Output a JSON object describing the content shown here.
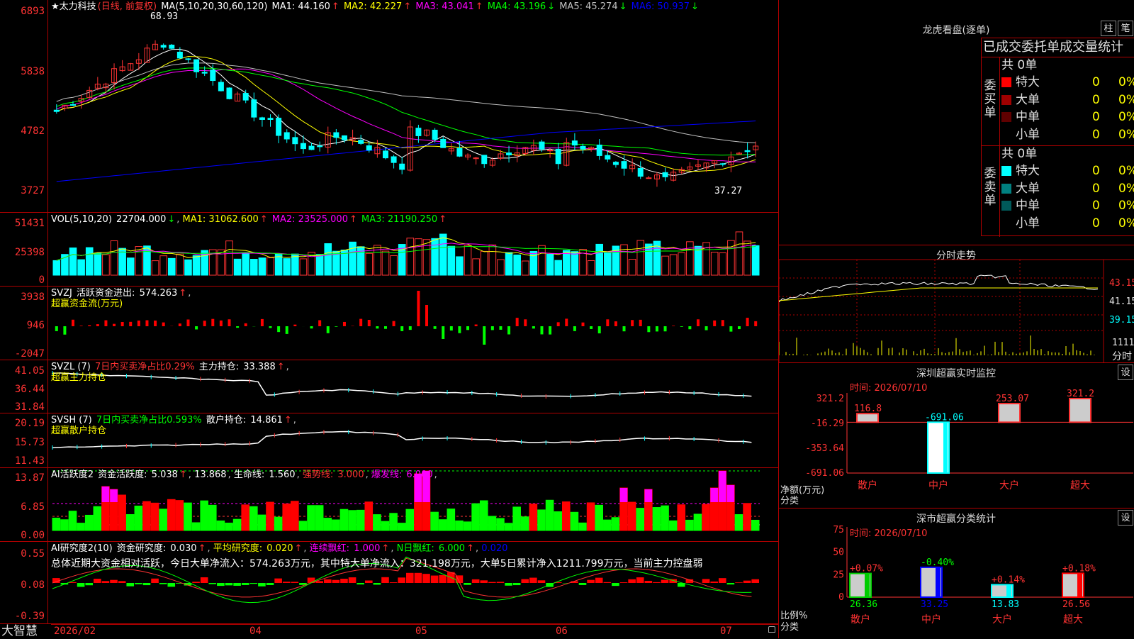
{
  "main": {
    "title": "★太力科技",
    "period": "(日线, 前复权)",
    "ma_header": "MA(5,10,20,30,60,120)",
    "ma": [
      {
        "label": "MA1:",
        "value": "44.160",
        "arrow": "↑",
        "color": "#ffffff"
      },
      {
        "label": "MA2:",
        "value": "42.227",
        "arrow": "↑",
        "color": "#ffff00"
      },
      {
        "label": "MA3:",
        "value": "43.041",
        "arrow": "↑",
        "color": "#ff00ff"
      },
      {
        "label": "MA4:",
        "value": "43.196",
        "arrow": "↓",
        "color": "#00ff00"
      },
      {
        "label": "MA5:",
        "value": "45.274",
        "arrow": "↓",
        "color": "#c0c0c0"
      },
      {
        "label": "MA6:",
        "value": "50.937",
        "arrow": "↓",
        "color": "#0000ff"
      }
    ],
    "ticks": [
      "6893",
      "5838",
      "4782",
      "3727"
    ],
    "high_label": "68.93",
    "low_label": "37.27"
  },
  "vol": {
    "header": "VOL(5,10,20)",
    "value": "22704.000",
    "value_arrow": "↓",
    "ma": [
      {
        "label": "MA1:",
        "value": "31062.600",
        "arrow": "↑",
        "color": "#ffff00"
      },
      {
        "label": "MA2:",
        "value": "23525.000",
        "arrow": "↑",
        "color": "#ff00ff"
      },
      {
        "label": "MA3:",
        "value": "21190.250",
        "arrow": "↑",
        "color": "#00ff00"
      }
    ],
    "ticks": [
      "51431",
      "25398",
      "0"
    ]
  },
  "svzj": {
    "header": "SVZJ",
    "label": "活跃资金进出:",
    "value": "574.263",
    "arrow": "↑",
    "sub": "超赢资金流(万元)",
    "ticks": [
      "3938",
      "946",
      "-2047"
    ]
  },
  "svzl": {
    "header": "SVZL (7)",
    "ratio": "7日内买卖净占比0.29%",
    "label": "主力持仓:",
    "value": "33.388",
    "arrow": "↑",
    "sub": "超赢主力持仓",
    "ticks": [
      "41.05",
      "36.44",
      "31.84"
    ]
  },
  "svsh": {
    "header": "SVSH (7)",
    "ratio": "7日内买卖净占比0.593%",
    "label": "散户持仓:",
    "value": "14.861",
    "arrow": "↑",
    "sub": "超赢散户持仓",
    "ticks": [
      "20.19",
      "15.73",
      "11.43"
    ]
  },
  "ai1": {
    "header": "AI活跃度2",
    "label": "资金活跃度:",
    "value": "5.038",
    "v2": "13.868",
    "life_label": "生命线:",
    "life": "1.560",
    "strong_label": "强势线:",
    "strong": "3.000",
    "burst_label": "爆发线:",
    "burst": "6.000",
    "ticks": [
      "13.87",
      "6.85",
      "0.00"
    ]
  },
  "ai2": {
    "header": "AI研究度2(10)",
    "label": "资金研究度:",
    "value": "0.030",
    "avg_label": "平均研究度:",
    "avg": "0.020",
    "lian_label": "连续飘红:",
    "lian": "1.000",
    "n_label": "N日飘红:",
    "n": "6.000",
    "last": "0.020",
    "summary": "总体近期大资金相对活跃，今日大单净流入：574.263万元，其中特大单净流入：321.198万元，大单5日累计净入1211.799万元，当前主力控盘弱",
    "ticks": [
      "0.55",
      "0.08",
      "-0.39"
    ]
  },
  "dates": [
    "2026/02",
    "04",
    "05",
    "06",
    "07"
  ],
  "brand": "大智慧",
  "lhb": {
    "title": "龙虎看盘(逐单)",
    "btn1": "柱",
    "btn2": "笔",
    "subtitle": "已成交委托单成交量统计",
    "buy_total": "共 0单",
    "sell_total": "共 0单",
    "buy_label": "委买单",
    "sell_label": "委卖单",
    "buy_rows": [
      {
        "name": "特大",
        "v": "0",
        "p": "0%",
        "color": "#ff0000"
      },
      {
        "name": "大单",
        "v": "0",
        "p": "0%",
        "color": "#a00000"
      },
      {
        "name": "中单",
        "v": "0",
        "p": "0%",
        "color": "#600000"
      },
      {
        "name": "小单",
        "v": "0",
        "p": "0%",
        "color": "#000000"
      }
    ],
    "sell_rows": [
      {
        "name": "特大",
        "v": "0",
        "p": "0%",
        "color": "#00ffff"
      },
      {
        "name": "大单",
        "v": "0",
        "p": "0%",
        "color": "#008080"
      },
      {
        "name": "中单",
        "v": "0",
        "p": "0%",
        "color": "#005a5a"
      },
      {
        "name": "小单",
        "v": "0",
        "p": "0%",
        "color": "#000000"
      }
    ]
  },
  "fenshi": {
    "title": "分时走势",
    "ticks": [
      "43.15",
      "41.15",
      "39.15"
    ],
    "vol_tick": "1111",
    "vol_label": "分时"
  },
  "monitor": {
    "title": "深圳超赢实时监控",
    "btn": "设",
    "time": "时间: 2026/07/10",
    "ticks": [
      "321.2",
      "-16.29",
      "-353.64",
      "-691.06"
    ],
    "axis_label": "净额(万元)",
    "axis_label2": "分类",
    "bars": [
      {
        "cat": "散户",
        "value": 116.8,
        "label": "116.8"
      },
      {
        "cat": "中户",
        "value": -691.06,
        "label": "-691.06"
      },
      {
        "cat": "大户",
        "value": 253.07,
        "label": "253.07"
      },
      {
        "cat": "超大",
        "value": 321.2,
        "label": "321.2"
      }
    ]
  },
  "classify": {
    "title": "深市超赢分类统计",
    "btn": "设",
    "time": "时间: 2026/07/10",
    "ticks": [
      "75",
      "50",
      "25",
      "0"
    ],
    "axis_label": "比例%",
    "axis_label2": "分类",
    "bars": [
      {
        "cat": "散户",
        "value": 26.36,
        "label": "26.36",
        "delta": "+0.07%",
        "color": "#00cc00"
      },
      {
        "cat": "中户",
        "value": 33.25,
        "label": "33.25",
        "delta": "-0.40%",
        "color": "#0000ff"
      },
      {
        "cat": "大户",
        "value": 13.83,
        "label": "13.83",
        "delta": "+0.14%",
        "color": "#00ffff"
      },
      {
        "cat": "超大",
        "value": 26.56,
        "label": "26.56",
        "delta": "+0.18%",
        "color": "#ff0000"
      }
    ]
  }
}
